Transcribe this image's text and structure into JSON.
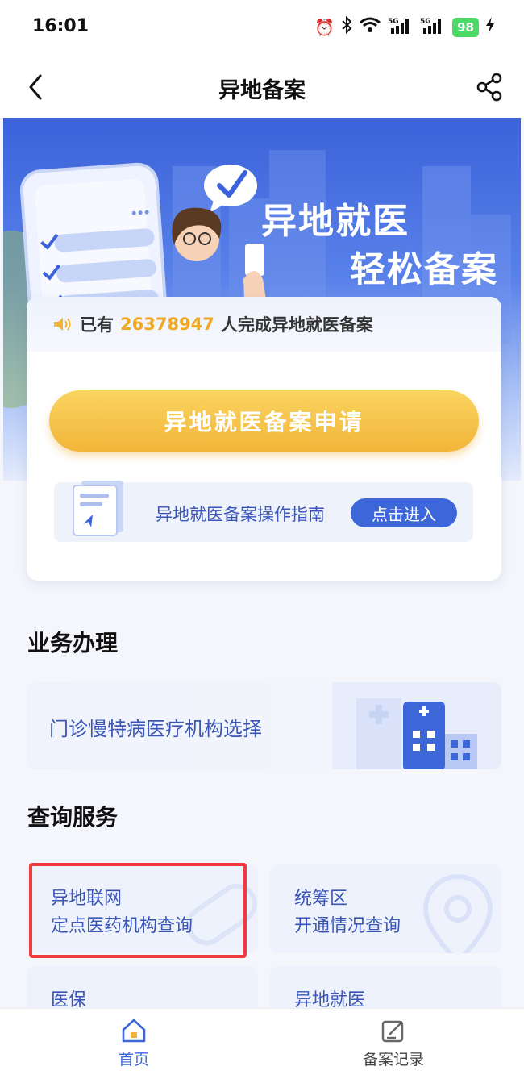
{
  "status_bar": {
    "time": "16:01",
    "battery": "98"
  },
  "nav": {
    "title": "异地备案"
  },
  "banner": {
    "line1": "异地就医",
    "line2": "轻松备案"
  },
  "notice": {
    "prefix": "已有",
    "count": "26378947",
    "suffix": "人完成异地就医备案"
  },
  "apply_button": "异地就医备案申请",
  "guide": {
    "text": "异地就医备案操作指南",
    "button": "点击进入"
  },
  "business": {
    "title": "业务办理",
    "item": "门诊慢特病医疗机构选择"
  },
  "query": {
    "title": "查询服务",
    "cards": [
      {
        "line1": "异地联网",
        "line2": "定点医药机构查询"
      },
      {
        "line1": "统筹区",
        "line2": "开通情况查询"
      },
      {
        "line1": "医保",
        "line2": ""
      },
      {
        "line1": "异地就医",
        "line2": ""
      }
    ]
  },
  "tabs": [
    {
      "label": "首页",
      "icon": "home-icon",
      "active": true
    },
    {
      "label": "备案记录",
      "icon": "record-icon",
      "active": false
    }
  ],
  "colors": {
    "primary": "#3d66d8",
    "accent": "#f0a820",
    "highlight": "#ef3b3b"
  }
}
